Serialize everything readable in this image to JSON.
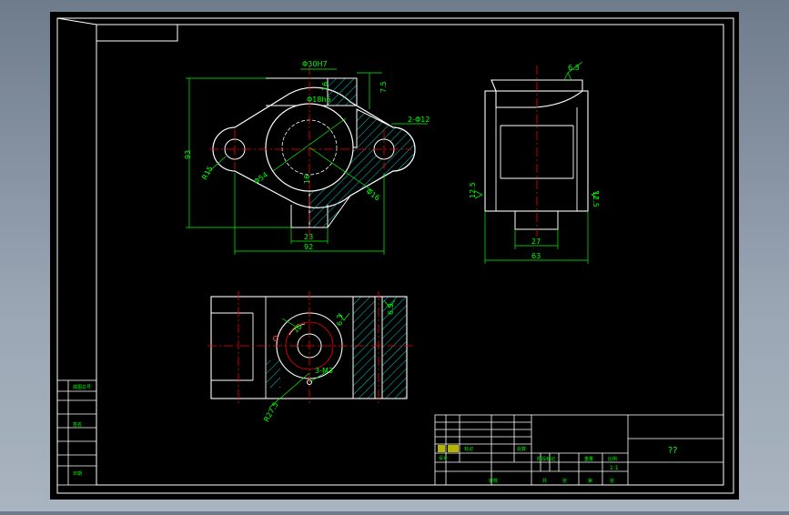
{
  "colors": {
    "background": "#000000",
    "frame": "#ffffff",
    "outline": "#ffffff",
    "centerline": "#ff0000",
    "dimension": "#00ff00",
    "hatch": "#00c8c8",
    "title_text": "#00ff00",
    "title_yellow": "#ffff00"
  },
  "front_view": {
    "dims": {
      "bore": "Φ30H7",
      "pilot": "Φ18h6",
      "hole": "2-Φ12",
      "height": "93",
      "radius": "R15",
      "dia54": "Φ54",
      "dia16": "Φ16",
      "small1": "16",
      "small2": "7.5",
      "small3": "16",
      "width23": "23",
      "width92": "92"
    }
  },
  "side_view": {
    "dims": {
      "rough_top": "6.3",
      "rough_left": "12.5",
      "rough_right": "12.5",
      "width27": "27",
      "width63": "63"
    }
  },
  "top_view": {
    "dims": {
      "r15": "15",
      "thread": "3-M3",
      "radius": "R27.5",
      "rough1": "6.3",
      "rough2": "6.3"
    }
  },
  "title_block": {
    "name_box": "??",
    "scale": "1:1",
    "left_labels": [
      "底图总号",
      "签名",
      "日期"
    ],
    "mid_labels": [
      "标记",
      "处数",
      "设计",
      "审核"
    ],
    "right_labels": [
      "阶段标记",
      "重量",
      "比例",
      "共",
      "张",
      "第",
      "张"
    ]
  }
}
